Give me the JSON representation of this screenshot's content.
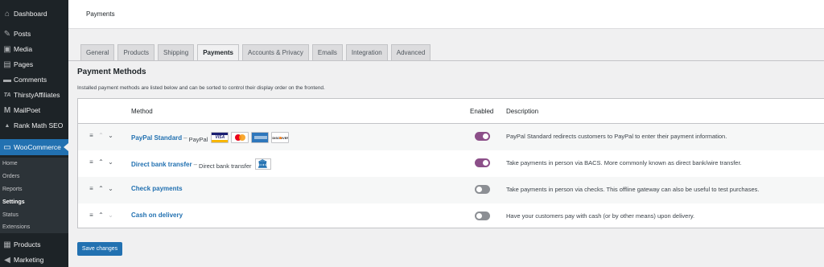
{
  "sidebar": {
    "items": [
      {
        "label": "Dashboard",
        "icon": "dashboard-icon",
        "glyph": "⌂"
      },
      {
        "label": "Posts",
        "icon": "pin-icon",
        "glyph": "✎"
      },
      {
        "label": "Media",
        "icon": "media-icon",
        "glyph": "▣"
      },
      {
        "label": "Pages",
        "icon": "pages-icon",
        "glyph": "▤"
      },
      {
        "label": "Comments",
        "icon": "comments-icon",
        "glyph": "▬"
      },
      {
        "label": "ThirstyAffiliates",
        "icon": "thirstyaffiliates-icon",
        "glyph": "TA"
      },
      {
        "label": "MailPoet",
        "icon": "mailpoet-icon",
        "glyph": "M"
      },
      {
        "label": "Rank Math SEO",
        "icon": "rankmath-icon",
        "glyph": "▲"
      },
      {
        "label": "WooCommerce",
        "icon": "woocommerce-icon",
        "glyph": "▭"
      }
    ],
    "submenu": [
      "Home",
      "Orders",
      "Reports",
      "Settings",
      "Status",
      "Extensions"
    ],
    "bottom": [
      {
        "label": "Products",
        "icon": "products-icon",
        "glyph": "▦"
      },
      {
        "label": "Marketing",
        "icon": "marketing-icon",
        "glyph": "◀"
      }
    ]
  },
  "header": {
    "title": "Payments"
  },
  "tabs": [
    "General",
    "Products",
    "Shipping",
    "Payments",
    "Accounts & Privacy",
    "Emails",
    "Integration",
    "Advanced"
  ],
  "section": {
    "title": "Payment Methods",
    "description": "Installed payment methods are listed below and can be sorted to control their display order on the frontend."
  },
  "table": {
    "headers": {
      "method": "Method",
      "enabled": "Enabled",
      "description": "Description"
    },
    "rows": [
      {
        "name": "PayPal Standard",
        "dash": "–",
        "sub": "PayPal",
        "enabled": true,
        "description": "PayPal Standard redirects customers to PayPal to enter their payment information."
      },
      {
        "name": "Direct bank transfer",
        "dash": "–",
        "sub": "Direct bank transfer",
        "enabled": true,
        "description": "Take payments in person via BACS. More commonly known as direct bank/wire transfer."
      },
      {
        "name": "Check payments",
        "dash": "",
        "sub": "",
        "enabled": false,
        "description": "Take payments in person via checks. This offline gateway can also be useful to test purchases."
      },
      {
        "name": "Cash on delivery",
        "dash": "",
        "sub": "",
        "enabled": false,
        "description": "Have your customers pay with cash (or by other means) upon delivery."
      }
    ],
    "card_brands": [
      "VISA",
      "",
      "",
      "DISCOVER"
    ]
  },
  "save_label": "Save changes",
  "colors": {
    "accent": "#2271b1",
    "toggle_on": "#8c4f89",
    "sidebar": "#1d2327"
  }
}
